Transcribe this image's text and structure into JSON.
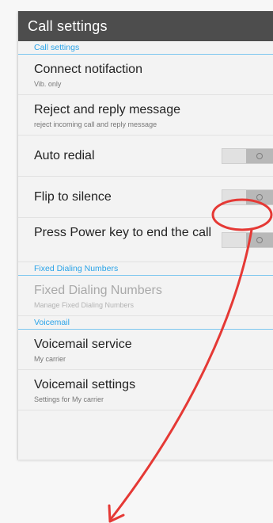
{
  "header": {
    "title": "Call settings"
  },
  "sections": {
    "call_settings": "Call settings",
    "fdn": "Fixed Dialing Numbers",
    "voicemail": "Voicemail"
  },
  "items": {
    "connect": {
      "title": "Connect notifaction",
      "sub": "Vib. only"
    },
    "reject": {
      "title": "Reject and reply message",
      "sub": "reject incoming call and reply message"
    },
    "auto_redial": {
      "title": "Auto redial",
      "state": "off"
    },
    "flip": {
      "title": "Flip to silence",
      "state": "off"
    },
    "power": {
      "title": "Press Power key to end the call",
      "state": "off"
    },
    "fdn": {
      "title": "Fixed Dialing Numbers",
      "sub": "Manage Fixed Dialing Numbers",
      "enabled": false
    },
    "vm_service": {
      "title": "Voicemail service",
      "sub": "My carrier"
    },
    "vm_settings": {
      "title": "Voicemail settings",
      "sub": "Settings for My carrier"
    }
  },
  "annotation": {
    "color": "#e53935",
    "icon": "arrow-icon"
  }
}
